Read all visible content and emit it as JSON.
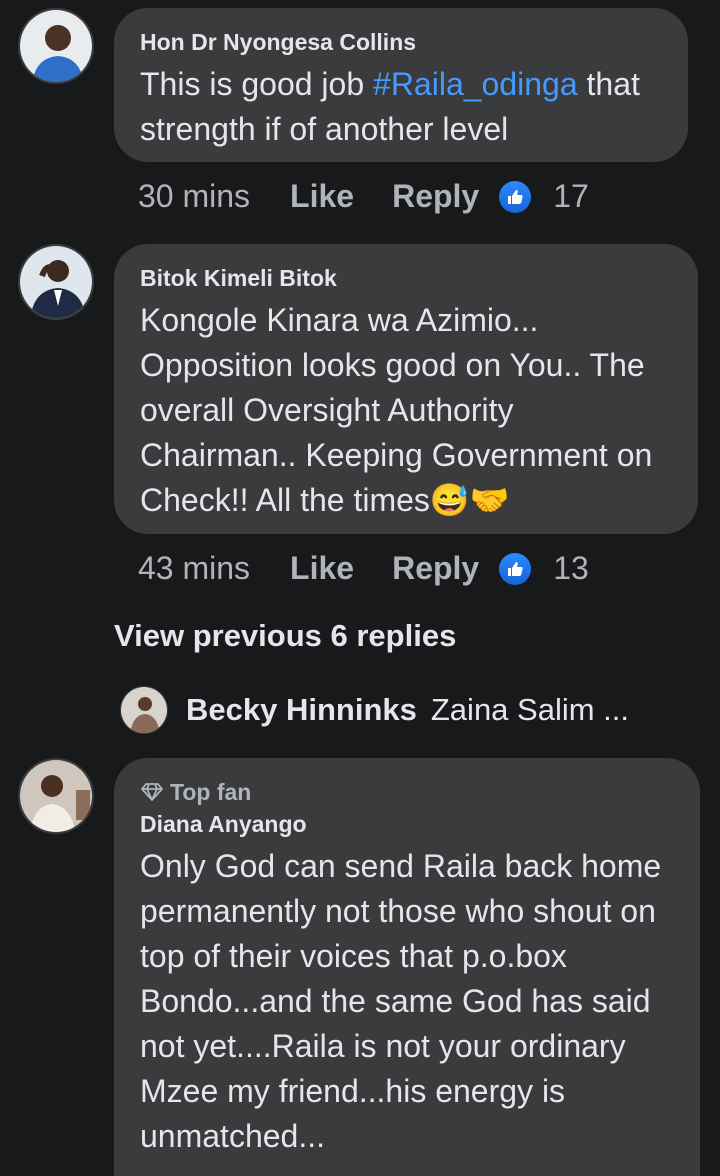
{
  "comments": [
    {
      "author": "Hon Dr Nyongesa Collins",
      "text_before": "This is good job ",
      "hashtag": "#Raila_odinga",
      "text_after": " that strength if of another level",
      "time": "30 mins",
      "like_label": "Like",
      "reply_label": "Reply",
      "reactions": "17"
    },
    {
      "author": "Bitok Kimeli Bitok",
      "text": "Kongole Kinara wa Azimio... Opposition looks good on You.. The overall Oversight Authority Chairman.. Keeping Government on Check!! All the times😅🤝",
      "time": "43 mins",
      "like_label": "Like",
      "reply_label": "Reply",
      "reactions": "13"
    },
    {
      "badge": "Top fan",
      "author": "Diana Anyango",
      "text": "Only God can send Raila back home permanently not those who shout on top of their voices that p.o.box Bondo...and the same God has said not yet....Raila is not your ordinary Mzee my friend...his energy is unmatched..."
    }
  ],
  "view_previous": "View previous 6 replies",
  "reply_preview": {
    "name": "Becky Hinninks",
    "text": "Zaina Salim ..."
  },
  "colors": {
    "background": "#18191a",
    "bubble": "#3a3b3c",
    "hashtag": "#4599ff",
    "like_blue": "#2e89ff"
  }
}
